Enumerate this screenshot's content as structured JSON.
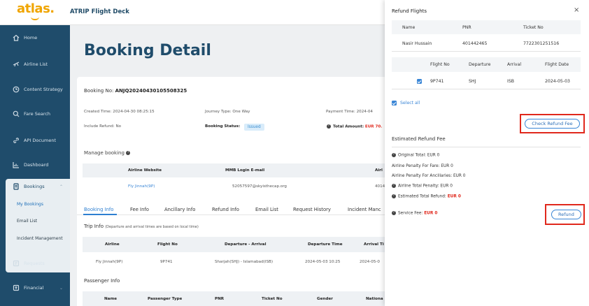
{
  "header": {
    "logo": "atlas.",
    "app_title": "ATRIP Flight Deck"
  },
  "sidebar": {
    "items": [
      {
        "label": "Home",
        "icon": "home-icon"
      },
      {
        "label": "Airline List",
        "icon": "plane-icon"
      },
      {
        "label": "Content Strategy",
        "icon": "strategy-icon"
      },
      {
        "label": "Fare Search",
        "icon": "search-icon"
      },
      {
        "label": "API Document",
        "icon": "link-icon"
      },
      {
        "label": "Dashboard",
        "icon": "chart-icon"
      },
      {
        "label": "Bookings",
        "icon": "bookings-icon"
      },
      {
        "label": "Requests",
        "icon": "requests-icon"
      },
      {
        "label": "Financial",
        "icon": "financial-icon"
      }
    ],
    "bookings_sub": [
      "My Bookings",
      "Email List",
      "Incident Management"
    ]
  },
  "main": {
    "title": "Booking Detail",
    "booking_no_label": "Booking No:",
    "booking_no": "ANJQ20240430105508325",
    "created_time": "Created Time:  2024-04-30 08:25:15",
    "journey_type": "Journey Type:  One Way",
    "payment_time": "Payment Time:  2024-04",
    "include_refund": "Include Refund:  No",
    "booking_status_label": "Booking Status:",
    "booking_status": "Issued",
    "total_amount_label": "Total Amount:",
    "total_amount": "EUR 70.",
    "manage_booking": "Manage booking",
    "manage_headers": [
      "Airline Website",
      "MMB Login E-mail",
      "Airl"
    ],
    "manage_row": [
      "Fly Jinnah(9P)",
      "52057597@skyisthecap.org",
      "4014"
    ],
    "tabs": [
      "Booking Info",
      "Fee Info",
      "Ancillary Info",
      "Refund Info",
      "Email List",
      "Request History",
      "Incident Manc"
    ],
    "trip_info": "Trip Info",
    "trip_note": "(Departure and arrival times are based on local time)",
    "trip_headers": [
      "Airline",
      "Flight No",
      "Departure - Arrival",
      "Departure Time",
      "Arrival Ti"
    ],
    "trip_row": [
      "Fly Jinnah(9P)",
      "9P741",
      "Sharjah(SHJ) - Islamabad(ISB)",
      "2024-05-03 10:25",
      "2024-05-0"
    ],
    "passenger_info": "Passenger Info",
    "passenger_headers": [
      "Name",
      "Passenger Type",
      "PNR",
      "Ticket No",
      "Gender",
      "Nationa"
    ]
  },
  "refund_panel": {
    "title": "Refund Flights",
    "close": "×",
    "pax_headers": [
      "Name",
      "PNR",
      "Ticket No"
    ],
    "pax_row": [
      "Nasir Hussain",
      "401442465",
      "7722301251516"
    ],
    "flight_headers": [
      "Flight No",
      "Departure",
      "Arrival",
      "Flight Date"
    ],
    "flight_row": [
      "9P741",
      "SHJ",
      "ISB",
      "2024-05-03"
    ],
    "select_all": "Select all",
    "check_button": "Check Refund Fee",
    "estimated_title": "Estimated Refund Fee",
    "original_total": "Original Total:  EUR 0",
    "penalty_fare": "Airline Penalty For Fare:  EUR 0",
    "penalty_anc": "Airline Penalty For Ancillaries:  EUR 0",
    "total_penalty": "Airline Total Penalty:  EUR 0",
    "est_total_label": "Estimated Total Refund:",
    "est_total_value": "EUR 0",
    "service_fee_label": "Service Fee:",
    "service_fee_value": "EUR 0",
    "refund_button": "Refund"
  }
}
